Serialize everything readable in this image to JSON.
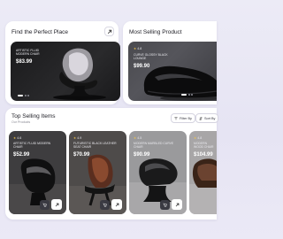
{
  "find_card": {
    "title": "Find the Perfect Place",
    "product": {
      "name": "ARTISTIC FLUID MODERN CHAIR",
      "price": "$83.99"
    }
  },
  "best_card": {
    "title": "Most Selling Product",
    "product": {
      "rating": "4.8",
      "name": "CURVE GLOSSY BLACK LOUNGE",
      "price": "$99.90"
    }
  },
  "top_selling": {
    "title": "Top Selling Items",
    "subtitle": "Our Products",
    "filter_label": "Filter By",
    "sort_label": "Sort By",
    "items": [
      {
        "rating": "4.6",
        "name": "ARTISTIC FLUID MODERN CHAIR",
        "price": "$52.99"
      },
      {
        "rating": "4.9",
        "name": "FUTURISTIC BLACK LEATHER SEAT CHAIR",
        "price": "$70.99"
      },
      {
        "rating": "4.5",
        "name": "MODERN MARBLED CURVE CHAIR",
        "price": "$90.99"
      },
      {
        "rating": "4.8",
        "name": "MODERN WOOD CHAIR",
        "price": "$104.99"
      }
    ]
  },
  "colors": {
    "background": "#e8e6f4",
    "card": "#ffffff",
    "accent_star": "#f0c24a",
    "dark_button": "#3a3a42"
  },
  "icons": [
    "arrow-up-right-icon",
    "star-icon",
    "filter-icon",
    "sort-icon",
    "cart-icon",
    "arrow-up-right-icon"
  ]
}
